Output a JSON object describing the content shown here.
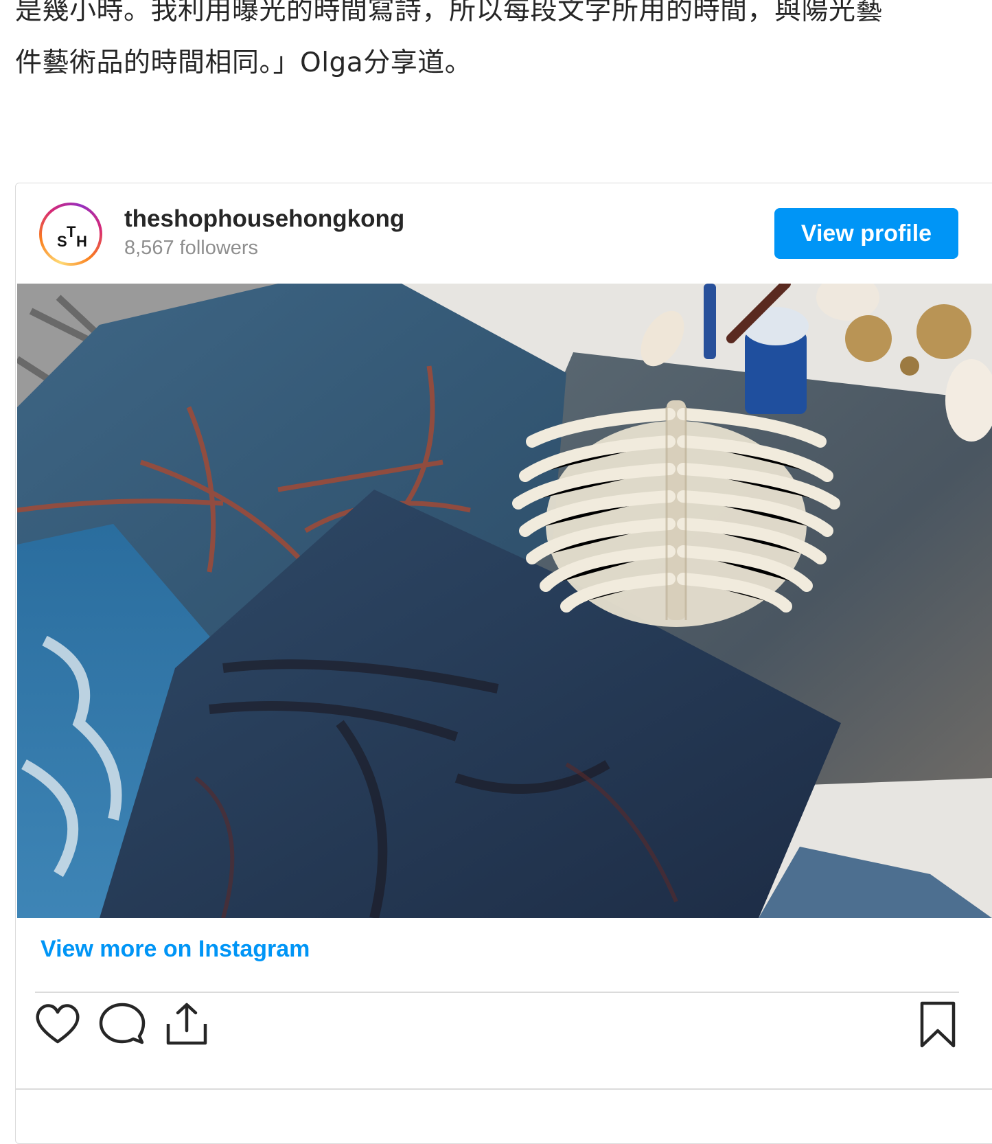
{
  "article": {
    "line1": "是幾小時。我利用曝光的時間寫詩，所以每段文字所用的時間，與陽光藝",
    "line2": "件藝術品的時間相同。」Olga分享道。"
  },
  "embed": {
    "avatar_letters": [
      "S",
      "T",
      "H"
    ],
    "username": "theshophousehongkong",
    "followers": "8,567 followers",
    "view_profile_label": "View profile",
    "view_more_label": "View more on Instagram",
    "accent_color": "#0095f6",
    "actions": {
      "like_icon": "heart-icon",
      "comment_icon": "comment-icon",
      "share_icon": "share-icon",
      "save_icon": "bookmark-icon"
    }
  }
}
